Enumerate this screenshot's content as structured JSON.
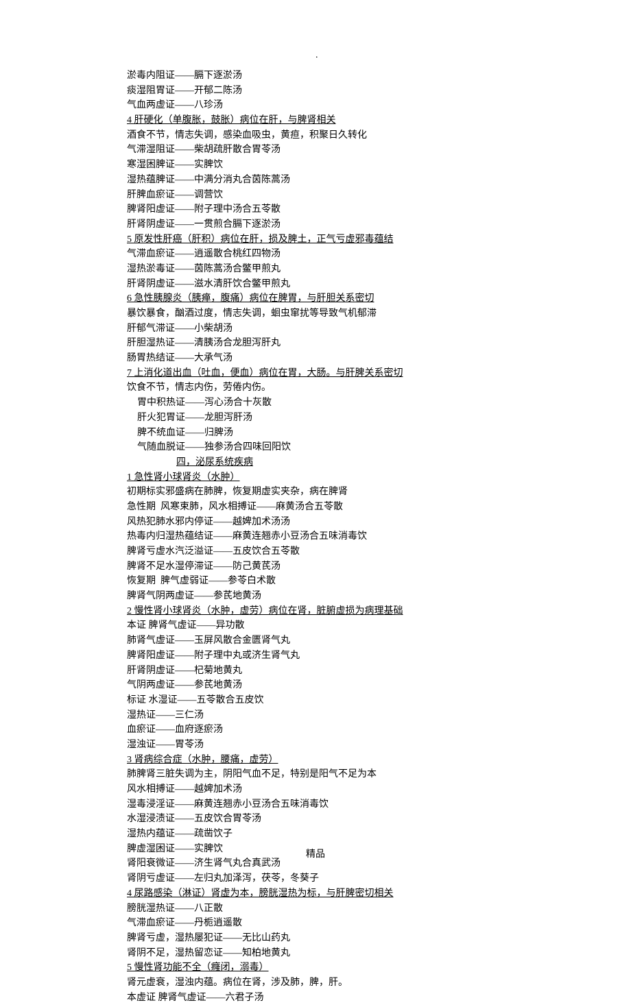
{
  "topDot": ".",
  "lines": [
    {
      "text": "淤毒内阻证——膈下逐淤汤",
      "cls": ""
    },
    {
      "text": "痰湿阻胃证——开郁二陈汤",
      "cls": ""
    },
    {
      "text": "气血两虚证——八珍汤",
      "cls": ""
    },
    {
      "text": "4 肝硬化（单腹胀，鼓胀）病位在肝，与脾肾相关",
      "cls": "u"
    },
    {
      "text": "酒食不节，情志失调，感染血吸虫，黄疸，积聚日久转化",
      "cls": ""
    },
    {
      "text": "气滞湿阻证——柴胡疏肝散合胃苓汤",
      "cls": ""
    },
    {
      "text": "寒湿困脾证——实脾饮",
      "cls": ""
    },
    {
      "text": "湿热蕴脾证——中满分消丸合茵陈蒿汤",
      "cls": ""
    },
    {
      "text": "肝脾血瘀证——调营饮",
      "cls": ""
    },
    {
      "text": "脾肾阳虚证——附子理中汤合五苓散",
      "cls": ""
    },
    {
      "text": "肝肾阴虚证——一贯煎合膈下逐淤汤",
      "cls": ""
    },
    {
      "text": "5 原发性肝癌（肝积）病位在肝，损及脾土，正气亏虚邪毒蕴结",
      "cls": "u"
    },
    {
      "text": "气滞血瘀证——逍遥散合桃红四物汤",
      "cls": ""
    },
    {
      "text": "湿热淤毒证——茵陈蒿汤合鳖甲煎丸",
      "cls": ""
    },
    {
      "text": "肝肾阴虚证——滋水清肝饮合鳖甲煎丸",
      "cls": ""
    },
    {
      "text": "6 急性胰腺炎（胰瘅，腹痛）病位在脾胃，与肝胆关系密切",
      "cls": "u"
    },
    {
      "text": "暴饮暴食，酗酒过度，情志失调，蛔虫窜扰等导致气机郁滞",
      "cls": ""
    },
    {
      "text": "肝郁气滞证——小柴胡汤",
      "cls": ""
    },
    {
      "text": "肝胆湿热证——清胰汤合龙胆泻肝丸",
      "cls": ""
    },
    {
      "text": "肠胃热结证——大承气汤",
      "cls": ""
    },
    {
      "text": "7 上消化道出血（吐血，便血）病位在胃，大肠。与肝脾关系密切",
      "cls": "u"
    },
    {
      "text": "饮食不节，情志内伤，劳倦内伤。",
      "cls": ""
    },
    {
      "text": "胃中积热证——泻心汤合十灰散",
      "cls": "indent1"
    },
    {
      "text": "肝火犯胃证——龙胆泻肝汤",
      "cls": "indent1"
    },
    {
      "text": "脾不统血证——归脾汤",
      "cls": "indent1"
    },
    {
      "text": "气随血脱证——独参汤合四味回阳饮",
      "cls": "indent1"
    },
    {
      "text": "四，泌尿系统疾病",
      "cls": "u indent2"
    },
    {
      "text": "1 急性肾小球肾炎（水肿）",
      "cls": "u"
    },
    {
      "text": "初期标实邪盛病在肺脾，恢复期虚实夹杂，病在脾肾",
      "cls": ""
    },
    {
      "text": "急性期  风寒束肺，风水相搏证——麻黄汤合五苓散",
      "cls": ""
    },
    {
      "text": "风热犯肺水邪内停证——越婢加术汤汤",
      "cls": ""
    },
    {
      "text": "热毒内归湿热蕴结证——麻黄连翘赤小豆汤合五味消毒饮",
      "cls": ""
    },
    {
      "text": "脾肾亏虚水汽泛溢证——五皮饮合五苓散",
      "cls": ""
    },
    {
      "text": "脾肾不足水湿停滞证——防己黄芪汤",
      "cls": ""
    },
    {
      "text": "恢复期  脾气虚弱证——参苓白术散",
      "cls": ""
    },
    {
      "text": "脾肾气阴两虚证——参芪地黄汤",
      "cls": ""
    },
    {
      "text": "2 慢性肾小球肾炎（水肿，虚劳）病位在肾，脏腑虚损为病理基础",
      "cls": "u"
    },
    {
      "text": "本证 脾肾气虚证——异功散",
      "cls": ""
    },
    {
      "text": "肺肾气虚证——玉屏风散合金匮肾气丸",
      "cls": ""
    },
    {
      "text": "脾肾阳虚证——附子理中丸或济生肾气丸",
      "cls": ""
    },
    {
      "text": "肝肾阴虚证——杞菊地黄丸",
      "cls": ""
    },
    {
      "text": "气阴两虚证——参芪地黄汤",
      "cls": ""
    },
    {
      "text": "标证 水湿证——五苓散合五皮饮",
      "cls": ""
    },
    {
      "text": "湿热证——三仁汤",
      "cls": ""
    },
    {
      "text": "血瘀证——血府逐瘀汤",
      "cls": ""
    },
    {
      "text": "湿浊证——胃苓汤",
      "cls": ""
    },
    {
      "text": "3 肾病综合症（水肿，腰痛，虚劳）",
      "cls": "u"
    },
    {
      "text": "肺脾肾三脏失调为主，阴阳气血不足，特别是阳气不足为本",
      "cls": ""
    },
    {
      "text": "风水相搏证——越婢加术汤",
      "cls": ""
    },
    {
      "text": "湿毒浸淫证——麻黄连翘赤小豆汤合五味消毒饮",
      "cls": ""
    },
    {
      "text": "水湿浸渍证——五皮饮合胃苓汤",
      "cls": ""
    },
    {
      "text": "湿热内蕴证——疏凿饮子",
      "cls": ""
    },
    {
      "text": "脾虚湿困证——实脾饮",
      "cls": ""
    },
    {
      "text": "肾阳衰微证——济生肾气丸合真武汤",
      "cls": ""
    },
    {
      "text": "肾阴亏虚证——左归丸加泽泻，茯苓，冬葵子",
      "cls": ""
    },
    {
      "text": "4 尿路感染（淋证）肾虚为本，膀胱湿热为标，与肝脾密切相关",
      "cls": "u"
    },
    {
      "text": "膀胱湿热证——八正散",
      "cls": ""
    },
    {
      "text": "气滞血瘀证——丹栀逍遥散",
      "cls": ""
    },
    {
      "text": "脾肾亏虚，湿热屡犯证——无比山药丸",
      "cls": ""
    },
    {
      "text": "肾阴不足，湿热留恋证——知柏地黄丸",
      "cls": ""
    },
    {
      "text": "5 慢性肾功能不全（癃闭，溺毒）",
      "cls": "u"
    },
    {
      "text": "肾元虚衰，湿浊内蕴。病位在肾，涉及肺，脾，肝。",
      "cls": ""
    },
    {
      "text": "本虚证 脾肾气虚证——六君子汤",
      "cls": ""
    }
  ],
  "footer": "精品"
}
